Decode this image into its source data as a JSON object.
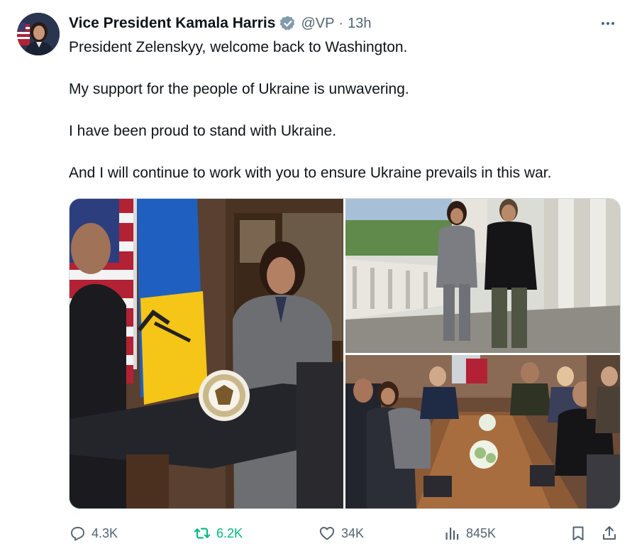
{
  "author": {
    "display_name": "Vice President Kamala Harris",
    "handle": "@VP",
    "separator": "·",
    "time": "13h"
  },
  "tweet": {
    "paragraphs": [
      "President Zelenskyy, welcome back to Washington.",
      "My support for the people of Ukraine is unwavering.",
      "I have been proud to stand with Ukraine.",
      "And I will continue to work with you to ensure Ukraine prevails in this war."
    ]
  },
  "actions": {
    "replies": "4.3K",
    "reposts": "6.2K",
    "likes": "34K",
    "views": "845K"
  },
  "colors": {
    "text": "#0f1419",
    "secondary": "#536471",
    "verified_badge": "#829aab",
    "repost_active": "#00ba7c",
    "border": "#cfd9de"
  },
  "icons": {
    "verified": "verified-badge-icon",
    "more": "more-options-icon",
    "reply": "reply-icon",
    "repost": "repost-icon",
    "like": "heart-icon",
    "views": "views-chart-icon",
    "bookmark": "bookmark-icon",
    "share": "share-icon"
  }
}
